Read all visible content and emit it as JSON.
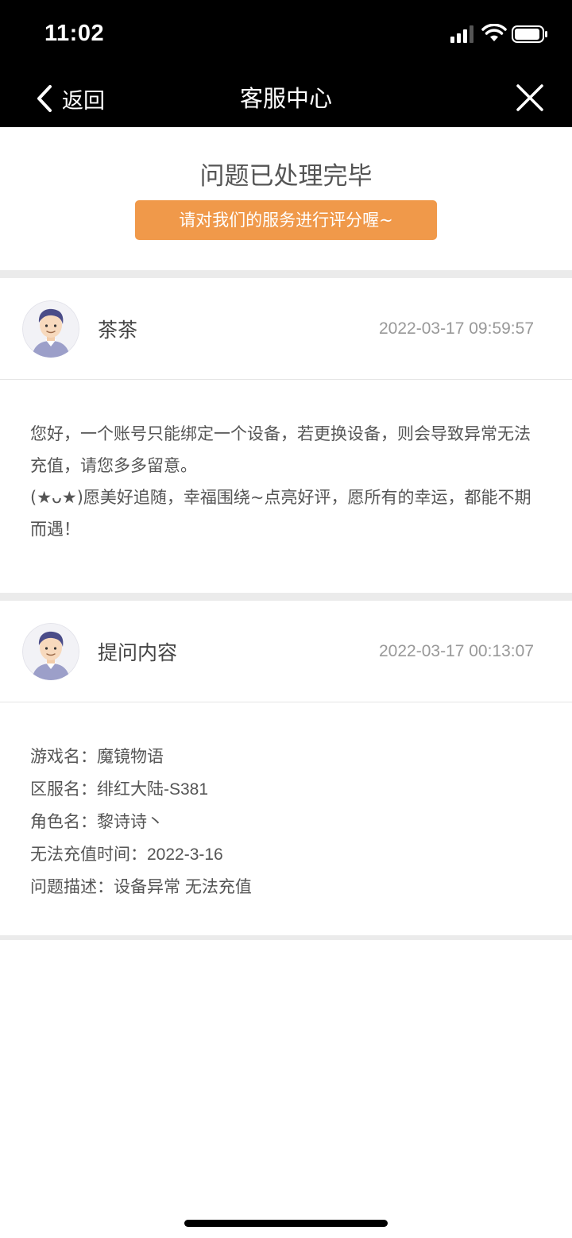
{
  "status_bar": {
    "time": "11:02"
  },
  "nav": {
    "back_label": "返回",
    "title": "客服中心"
  },
  "resolved": {
    "title": "问题已处理完毕",
    "rate_button": "请对我们的服务进行评分喔~"
  },
  "reply": {
    "name": "茶茶",
    "time": "2022-03-17 09:59:57",
    "message_line1": "您好，一个账号只能绑定一个设备，若更换设备，则会导致异常无法充值，请您多多留意。",
    "message_line2": "(★ᴗ★)愿美好追随，幸福围绕~点亮好评，愿所有的幸运，都能不期而遇！"
  },
  "question": {
    "name": "提问内容",
    "time": "2022-03-17 00:13:07",
    "fields": [
      {
        "label": "游戏名：",
        "value": "魔镜物语"
      },
      {
        "label": "区服名：",
        "value": "绯红大陆-S381"
      },
      {
        "label": "角色名：",
        "value": "黎诗诗丶"
      },
      {
        "label": "无法充值时间：",
        "value": "2022-3-16"
      },
      {
        "label": "问题描述：",
        "value": "设备异常 无法充值"
      }
    ]
  },
  "colors": {
    "accent": "#F0994A",
    "header_bg": "#000000",
    "divider": "#EBEBEB"
  }
}
